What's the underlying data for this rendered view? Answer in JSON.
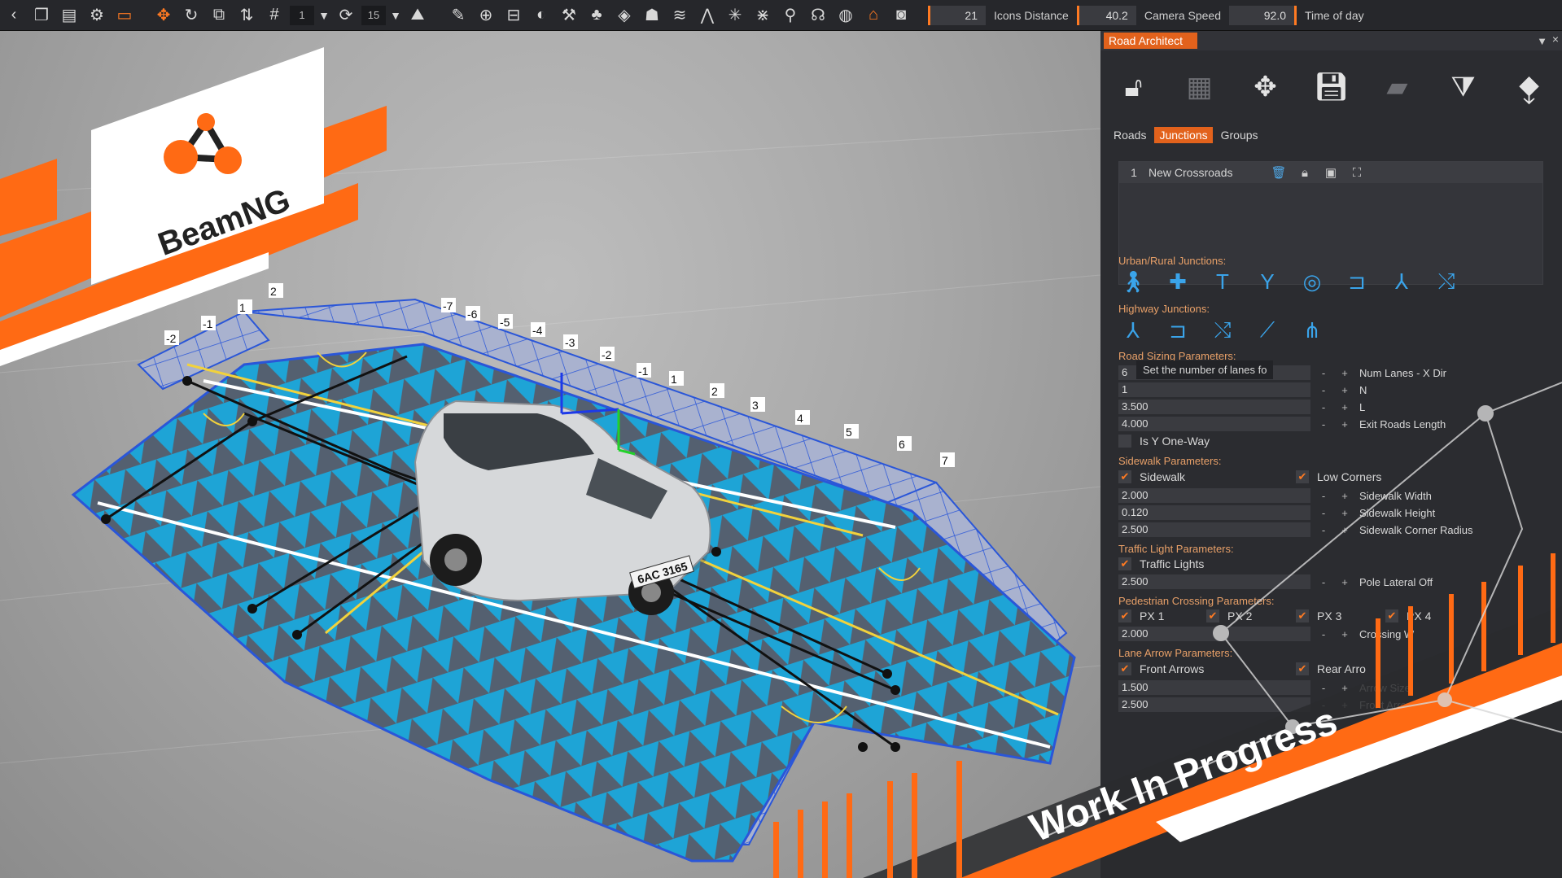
{
  "toolbar": {
    "icons": [
      "chevron-left-icon",
      "copy-icon",
      "paste-icon",
      "gear-icon",
      "car-icon",
      "move-icon",
      "rotate-icon",
      "scale-icon",
      "axis-icon",
      "grid-icon",
      "snap-icon",
      "rotate-snap-icon",
      "terrain-icon",
      "pencil-icon",
      "plus-circle-icon",
      "road-icon",
      "decal-icon",
      "paint-icon",
      "forest-icon",
      "layers-icon",
      "river-icon",
      "mesh-road-icon",
      "road-architect-icon",
      "lightning-icon",
      "nodes-icon",
      "pin-icon",
      "sensor-icon",
      "map-icon",
      "car-garage-icon",
      "camera-icon"
    ],
    "grid_step": "1",
    "rotate_step": "15",
    "icons_distance_value": "21",
    "icons_distance_label": "Icons Distance",
    "camera_speed_value": "40.2",
    "camera_speed_label": "Camera Speed",
    "time_of_day_value": "92.0",
    "time_of_day_label": "Time of day"
  },
  "viewport": {
    "logo_text": "BeamNG",
    "banner_text": "Work In Progress",
    "grid_labels_top": [
      "-7",
      "-6",
      "-5",
      "-4",
      "-3",
      "-2",
      "-1",
      "1",
      "2",
      "3",
      "4",
      "5",
      "6",
      "7"
    ],
    "grid_labels_left": [
      "-2",
      "-1",
      "1",
      "2"
    ],
    "license_plate": "6AC 3165"
  },
  "panel": {
    "title": "Road Architect",
    "collapse_icon": "▼",
    "close_icon": "×",
    "tabs": [
      "Roads",
      "Junctions",
      "Groups"
    ],
    "selected_tab": "Junctions",
    "junctions": [
      {
        "index": "1",
        "name": "New Crossroads"
      }
    ],
    "urban_label": "Urban/Rural Junctions:",
    "highway_label": "Highway Junctions:",
    "road_sizing_label": "Road Sizing Parameters:",
    "road_sizing": [
      {
        "value": "6",
        "label": "Num Lanes - X Dir"
      },
      {
        "value": "1",
        "label": "N"
      },
      {
        "value": "3.500",
        "label": "L"
      },
      {
        "value": "4.000",
        "label": "Exit Roads Length"
      }
    ],
    "tooltip": "Set the number of lanes fo",
    "one_way_label": "Is Y One-Way",
    "one_way_checked": false,
    "sidewalk_params_label": "Sidewalk Parameters:",
    "sidewalk_label": "Sidewalk",
    "low_corners_label": "Low Corners",
    "sidewalk_values": [
      {
        "value": "2.000",
        "label": "Sidewalk Width"
      },
      {
        "value": "0.120",
        "label": "Sidewalk Height"
      },
      {
        "value": "2.500",
        "label": "Sidewalk Corner Radius"
      }
    ],
    "traffic_params_label": "Traffic Light Parameters:",
    "traffic_lights_label": "Traffic Lights",
    "traffic_value": "2.500",
    "pole_label": "Pole Lateral Off",
    "pedestrian_label": "Pedestrian Crossing Parameters:",
    "px_labels": [
      "PX 1",
      "PX 2",
      "PX 3",
      "PX 4"
    ],
    "crossing_value": "2.000",
    "crossing_label": "Crossing W",
    "lane_arrow_label": "Lane Arrow Parameters:",
    "front_arrows_label": "Front Arrows",
    "rear_arrows_label": "Rear Arro",
    "arrow_values": [
      {
        "value": "1.500",
        "label": "Arrow Size"
      },
      {
        "value": "2.500",
        "label": "Front Arrow Distance"
      }
    ],
    "minus": "-",
    "plus": "+"
  },
  "colors": {
    "accent": "#e2621c",
    "road_blue": "#1ea4d6",
    "grid_line": "#2a56d8",
    "lane_yellow": "#f2d23c"
  }
}
